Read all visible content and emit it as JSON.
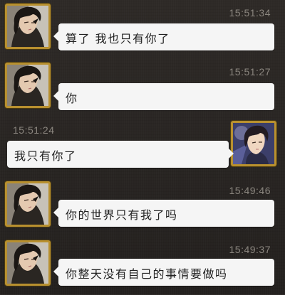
{
  "messages": [
    {
      "side": "left",
      "time": "15:51:34",
      "text": "算了 我也只有你了",
      "avatar": "dark-haired-man-avatar-icon"
    },
    {
      "side": "left",
      "time": "15:51:27",
      "text": "你",
      "avatar": "dark-haired-man-avatar-icon"
    },
    {
      "side": "right",
      "time": "15:51:24",
      "text": "我只有你了",
      "avatar": "young-man-avatar-icon"
    },
    {
      "side": "left",
      "time": "15:49:46",
      "text": "你的世界只有我了吗",
      "avatar": "dark-haired-man-avatar-icon"
    },
    {
      "side": "left",
      "time": "15:49:37",
      "text": "你整天没有自己的事情要做吗",
      "avatar": "dark-haired-man-avatar-icon"
    }
  ],
  "colors": {
    "background": "#2a2724",
    "bubble": "#f5f5f5",
    "timestamp": "#8b867f",
    "avatar_frame": "#b8902f"
  }
}
